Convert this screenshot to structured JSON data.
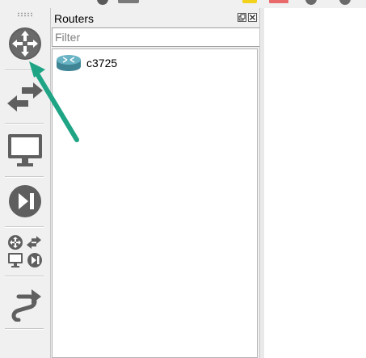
{
  "left_toolbar": {
    "tools": [
      {
        "name": "routers",
        "icon": "router-icon"
      },
      {
        "name": "switches",
        "icon": "switch-icon"
      },
      {
        "name": "end-devices",
        "icon": "end-device-icon"
      },
      {
        "name": "security-devices",
        "icon": "security-device-icon"
      },
      {
        "name": "all-devices",
        "icon": "all-devices-icon"
      },
      {
        "name": "add-link",
        "icon": "link-icon"
      }
    ]
  },
  "panel": {
    "title": "Routers",
    "filter_placeholder": "Filter",
    "filter_value": "",
    "items": [
      {
        "label": "c3725",
        "icon": "router-icon"
      }
    ]
  },
  "colors": {
    "tool_icon": "#606060",
    "router_item": "#5aa0b0",
    "annotation_arrow": "#1fa585"
  }
}
